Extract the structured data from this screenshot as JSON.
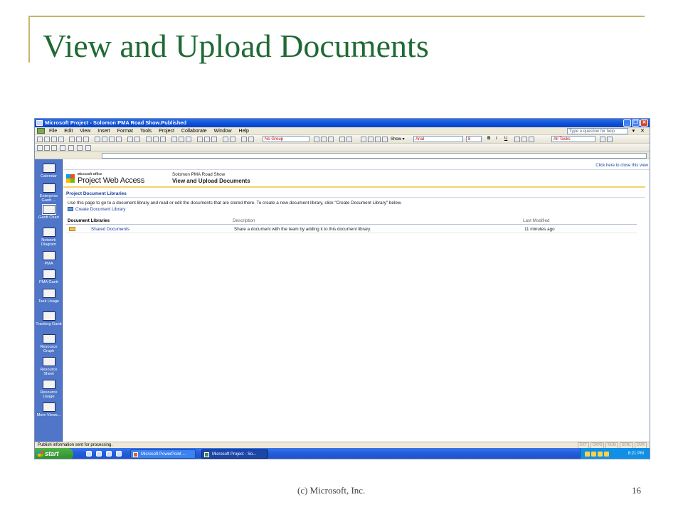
{
  "slide": {
    "title": "View and Upload Documents",
    "footer": "(c) Microsoft, Inc.",
    "page_number": "16"
  },
  "window": {
    "title": "Microsoft Project - Solomon PMA Road Show.Published",
    "controls": [
      "_",
      "❐",
      "✕"
    ]
  },
  "menubar": {
    "items": [
      "File",
      "Edit",
      "View",
      "Insert",
      "Format",
      "Tools",
      "Project",
      "Collaborate",
      "Window",
      "Help"
    ],
    "help_placeholder": "Type a question for help",
    "right_controls": "▾ ✕"
  },
  "toolbar": {
    "group_value": "No Group",
    "show_label": "Show ▾",
    "font_value": "Arial",
    "size_value": "8",
    "filter_value": "All Tasks",
    "format_buttons": [
      "B",
      "I",
      "U"
    ]
  },
  "viewbar": {
    "items": [
      "Calendar",
      "Enterprise Gantt ...",
      "Gantt Chart",
      "Network Diagram",
      "PMA",
      "PMA Gantt",
      "Task Usage",
      "Tracking Gantt",
      "Resource Graph",
      "Resource Sheet",
      "Resource Usage",
      "More Views..."
    ]
  },
  "pwa": {
    "close_link": "Click here to close this view",
    "logo_small": "Microsoft Office",
    "logo_big": "Project Web Access",
    "project_name": "Solomon PMA Road Show",
    "page_title": "View and Upload Documents",
    "section_title": "Project Document Libraries",
    "intro": "Use this page to go to a document library and read or edit the documents that are stored there. To create a new document library, click \"Create Document Library\" below.",
    "create_link": "Create Document Library",
    "table": {
      "headers": [
        "Document Libraries",
        "Description",
        "Last Modified"
      ],
      "rows": [
        {
          "name": "Shared Documents",
          "description": "Share a document with the team by adding it to this document library.",
          "modified": "11 minutes ago"
        }
      ]
    }
  },
  "statusbar": {
    "text": "Publish information sent for processing.",
    "indicators": [
      "EXT",
      "CAPS",
      "NUM",
      "SCRL",
      "OVR"
    ]
  },
  "taskbar": {
    "start_label": "start",
    "tasks": [
      "Microsoft PowerPoint ...",
      "Microsoft Project - So..."
    ],
    "time": "8:21 PM"
  }
}
